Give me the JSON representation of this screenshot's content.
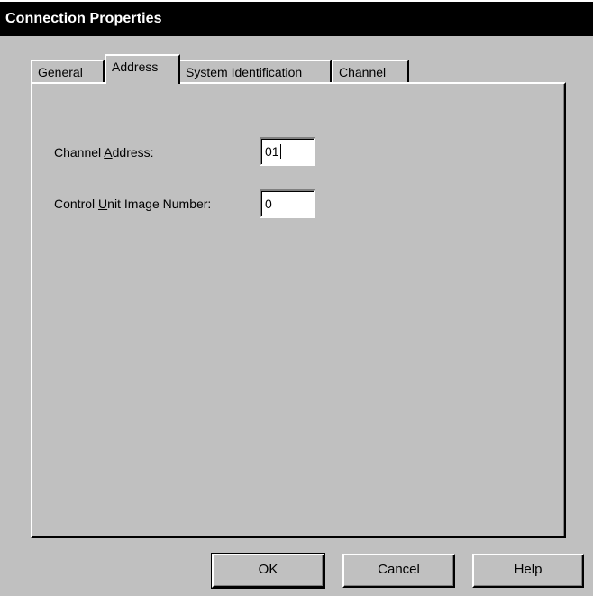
{
  "window": {
    "title": "Connection Properties"
  },
  "tabs": [
    {
      "label": "General",
      "active": false
    },
    {
      "label": "Address",
      "active": true
    },
    {
      "label": "System Identification",
      "active": false
    },
    {
      "label": "Channel",
      "active": false
    }
  ],
  "fields": {
    "channel_address": {
      "label_pre": "Channel ",
      "label_mnemonic": "A",
      "label_post": "ddress:",
      "value": "01"
    },
    "cu_image_number": {
      "label_pre": "Control ",
      "label_mnemonic": "U",
      "label_post": "nit Image Number:",
      "value": "0"
    }
  },
  "buttons": {
    "ok": "OK",
    "cancel": "Cancel",
    "help": "Help"
  },
  "colors": {
    "face": "#c0c0c0",
    "titlebar": "#000000",
    "titletext": "#ffffff"
  }
}
